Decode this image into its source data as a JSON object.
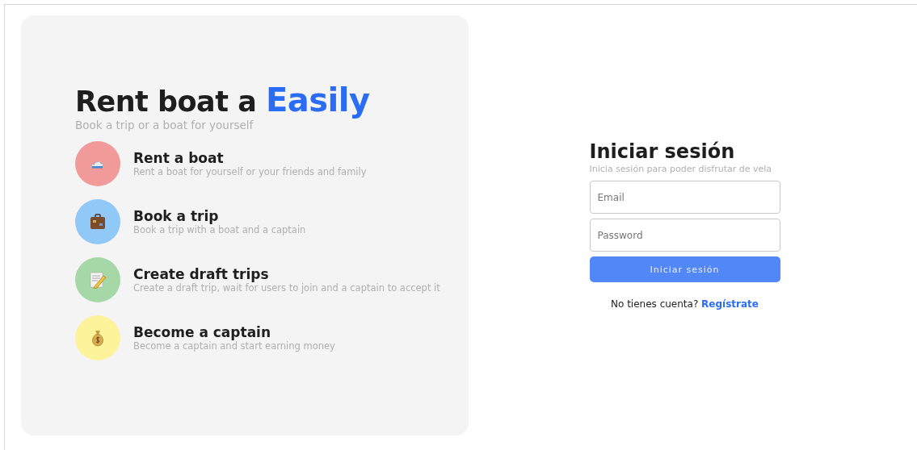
{
  "hero": {
    "title": "Rent boat a",
    "title_highlight": "Easily",
    "subtitle": "Book a trip or a boat for yourself",
    "features": [
      {
        "title": "Rent a boat",
        "description": "Rent a boat for yourself or your friends and family",
        "color": "#f09a9a"
      },
      {
        "title": "Book a trip",
        "description": "Book a trip with a boat and a captain",
        "color": "#90c8f8"
      },
      {
        "title": "Create draft trips",
        "description": "Create a draft trip, wait for users to join and a captain to accept it",
        "color": "#a5d8a6"
      },
      {
        "title": "Become a captain",
        "description": "Become a captain and start earning money",
        "color": "#fcf39a"
      }
    ]
  },
  "login": {
    "title": "Iniciar sesión",
    "subtitle": "Inicia sesión para poder disfrutar de vela",
    "fields": [
      {
        "placeholder": "Email"
      },
      {
        "placeholder": "Password"
      }
    ],
    "submit": "Iniciar sesión",
    "signup_prompt": "No tienes cuenta?",
    "signup_link": "Regístrate"
  }
}
